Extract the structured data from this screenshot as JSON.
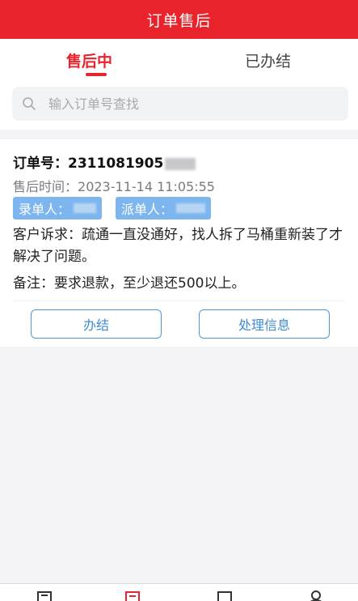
{
  "header": {
    "title": "订单售后"
  },
  "tabs": [
    {
      "label": "售后中",
      "active": true
    },
    {
      "label": "已办结",
      "active": false
    }
  ],
  "search": {
    "placeholder": "输入订单号查找"
  },
  "order": {
    "number_label": "订单号：",
    "number_value": "2311081905",
    "time_label": "售后时间：",
    "time_value": "2023-11-14 11:05:55",
    "recorder_label": "录单人：",
    "dispatcher_label": "派单人：",
    "complaint_label": "客户诉求：",
    "complaint_text": "疏通一直没通好，找人拆了马桶重新装了才解决了问题。",
    "remark_label": "备注：",
    "remark_text": "要求退款，至少退还500以上。",
    "actions": {
      "close_label": "办结",
      "info_label": "处理信息"
    }
  },
  "bottom_nav": {
    "icons": [
      "document-icon",
      "order-icon",
      "square-icon",
      "user-icon"
    ]
  },
  "colors": {
    "primary": "#e8232b",
    "tag_bg": "#7db6ee",
    "button_border": "#4d97d9"
  }
}
